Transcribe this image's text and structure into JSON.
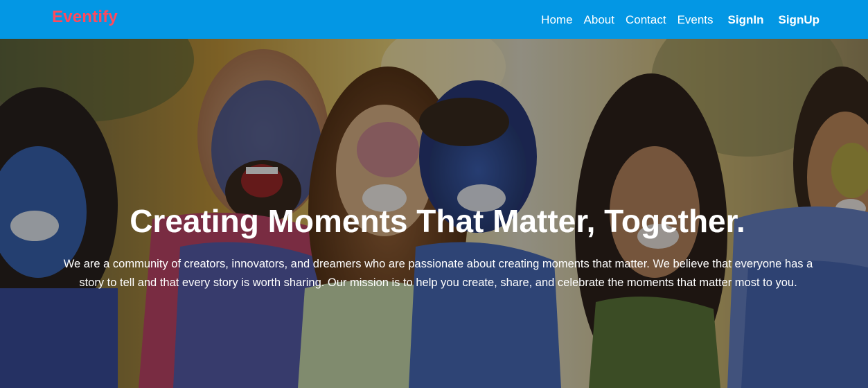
{
  "navbar": {
    "brand": "Eventify",
    "links": [
      "Home",
      "About",
      "Contact",
      "Events"
    ],
    "signin_label": "SignIn",
    "signup_label": "SignUp"
  },
  "hero": {
    "title": "Creating Moments That Matter, Together.",
    "description": "We are a community of creators, innovators, and dreamers who are passionate about creating moments that matter. We believe that everyone has a story to tell and that every story is worth sharing. Our mission is to help you create, share, and celebrate the moments that matter most to you."
  },
  "colors": {
    "navbar_bg": "#0397e4",
    "brand": "#ff4a5d",
    "text": "#ffffff"
  }
}
